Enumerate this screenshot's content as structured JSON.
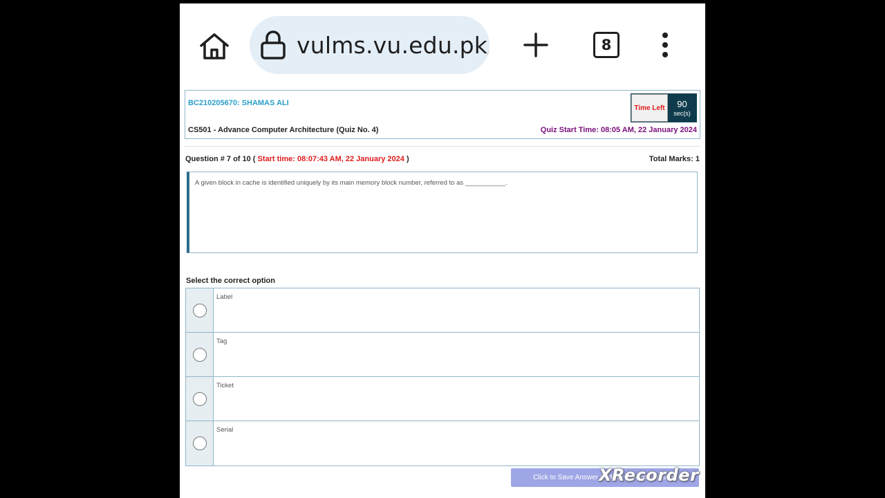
{
  "browser": {
    "url": "vulms.vu.edu.pk/(",
    "tab_count": "8"
  },
  "quiz": {
    "student": "BC210205670: SHAMAS ALI",
    "course": "CS501 - Advance Computer Architecture (Quiz No. 4)",
    "quiz_start": "Quiz Start Time: 08:05 AM, 22 January 2024",
    "timer_label": "Time Left",
    "timer_value": "90",
    "timer_unit": "sec(s)",
    "question_prefix": "Question # 7 of 10 ( ",
    "question_start": "Start time: 08:07:43 AM, 22 January 2024",
    "question_suffix": " )",
    "total_marks": "Total Marks: 1",
    "question_text": "A given block in cache is identified uniquely by its main memory block number, referred to as ___________.",
    "select_label": "Select the correct option",
    "options": [
      "Label",
      "Tag",
      "Ticket",
      "Serial"
    ],
    "save_label": "Click to Save Answer & Move to Next Question"
  },
  "watermark": "XRecorder",
  "colors": {
    "student_name": "#2a9fc9",
    "quiz_start": "#7a0f7a",
    "timer_bg": "#0f3c4c",
    "alert_red": "#e01b1b",
    "save_button": "#9ea6e6"
  }
}
